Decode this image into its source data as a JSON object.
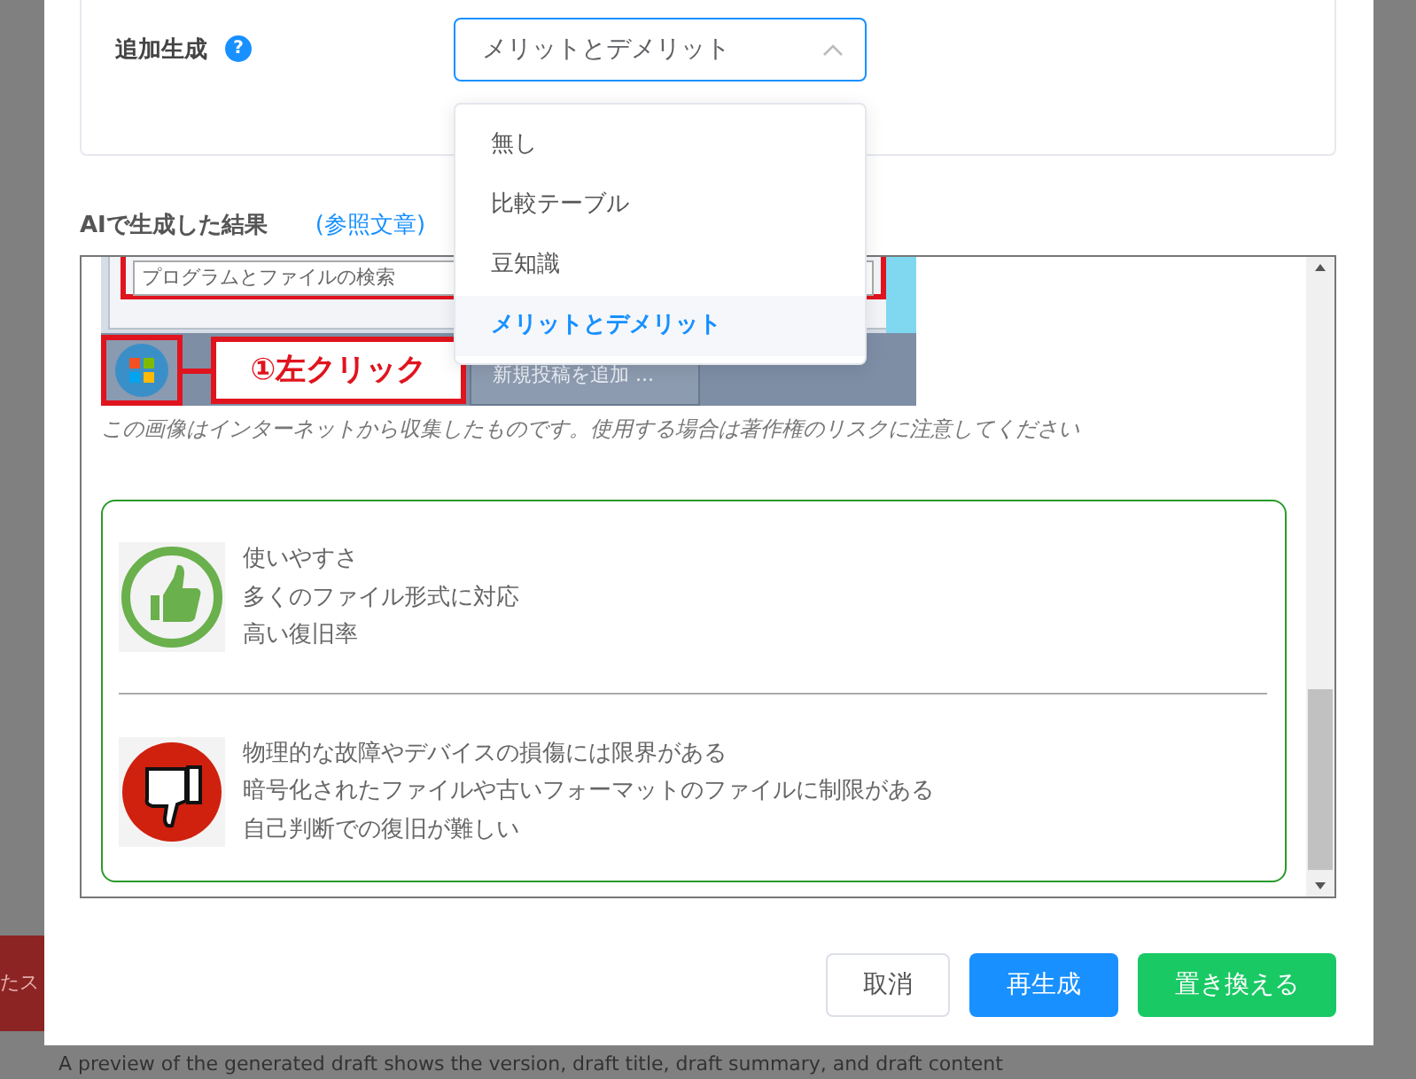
{
  "additional_generation": {
    "label": "追加生成",
    "help_icon": "?",
    "value": "メリットとデメリット",
    "expanded": true,
    "options": [
      {
        "label": "無し",
        "selected": false
      },
      {
        "label": "比較テーブル",
        "selected": false
      },
      {
        "label": "豆知識",
        "selected": false
      },
      {
        "label": "メリットとデメリット",
        "selected": true
      }
    ]
  },
  "result": {
    "title": "AIで生成した結果",
    "reference_link": "(参照文章)",
    "embedded_screenshot": {
      "search_placeholder": "プログラムとファイルの検索",
      "callout": "①左クリック",
      "taskbar_item": "新規投稿を追加 ..."
    },
    "caption": "この画像はインターネットから収集したものです。使用する場合は著作権のリスクに注意してください",
    "pros": [
      "使いやすさ",
      "多くのファイル形式に対応",
      "高い復旧率"
    ],
    "cons": [
      "物理的な故障やデバイスの損傷には限界がある",
      "暗号化されたファイルや古いフォーマットのファイルに制限がある",
      "自己判断での復旧が難しい"
    ]
  },
  "buttons": [
    {
      "label": "取消",
      "kind": "default"
    },
    {
      "label": "再生成",
      "kind": "primary"
    },
    {
      "label": "置き換える",
      "kind": "success"
    }
  ],
  "background": {
    "tab_label": "たス",
    "preview_text": "A preview of the generated draft shows the version, draft title, draft summary, and draft content"
  }
}
